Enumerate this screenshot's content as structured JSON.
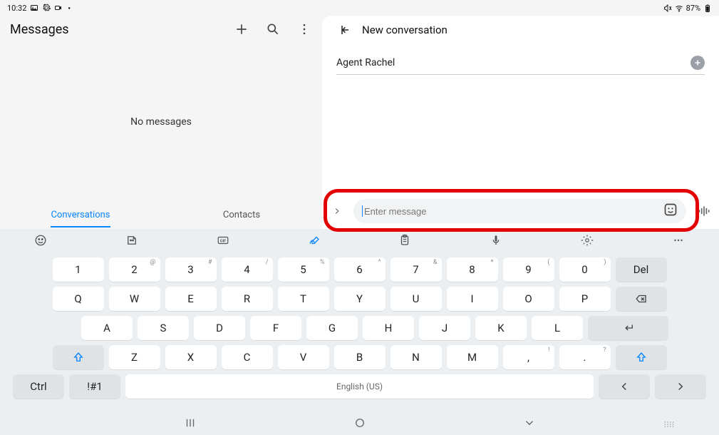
{
  "status": {
    "time": "10:32",
    "battery": "87%"
  },
  "left": {
    "title": "Messages",
    "empty": "No messages",
    "tabs": {
      "conversations": "Conversations",
      "contacts": "Contacts"
    }
  },
  "right": {
    "title": "New conversation",
    "recipient": "Agent Rachel",
    "compose": {
      "placeholder": "Enter message"
    }
  },
  "kb": {
    "row1": [
      "1",
      "2",
      "3",
      "4",
      "5",
      "6",
      "7",
      "8",
      "9",
      "0"
    ],
    "row1_sup": [
      "",
      "@",
      "#",
      "/",
      "%",
      "^",
      "&",
      "*",
      "(",
      ")"
    ],
    "del": "Del",
    "row2": [
      "Q",
      "W",
      "E",
      "R",
      "T",
      "Y",
      "U",
      "I",
      "O",
      "P"
    ],
    "row3": [
      "A",
      "S",
      "D",
      "F",
      "G",
      "H",
      "J",
      "K",
      "L"
    ],
    "row4": [
      "Z",
      "X",
      "C",
      "V",
      "B",
      "N",
      "M"
    ],
    "comma": ",",
    "comma_sup": "!",
    "period": ".",
    "period_sup": "?",
    "ctrl": "Ctrl",
    "sym": "!#1",
    "space": "English (US)"
  }
}
